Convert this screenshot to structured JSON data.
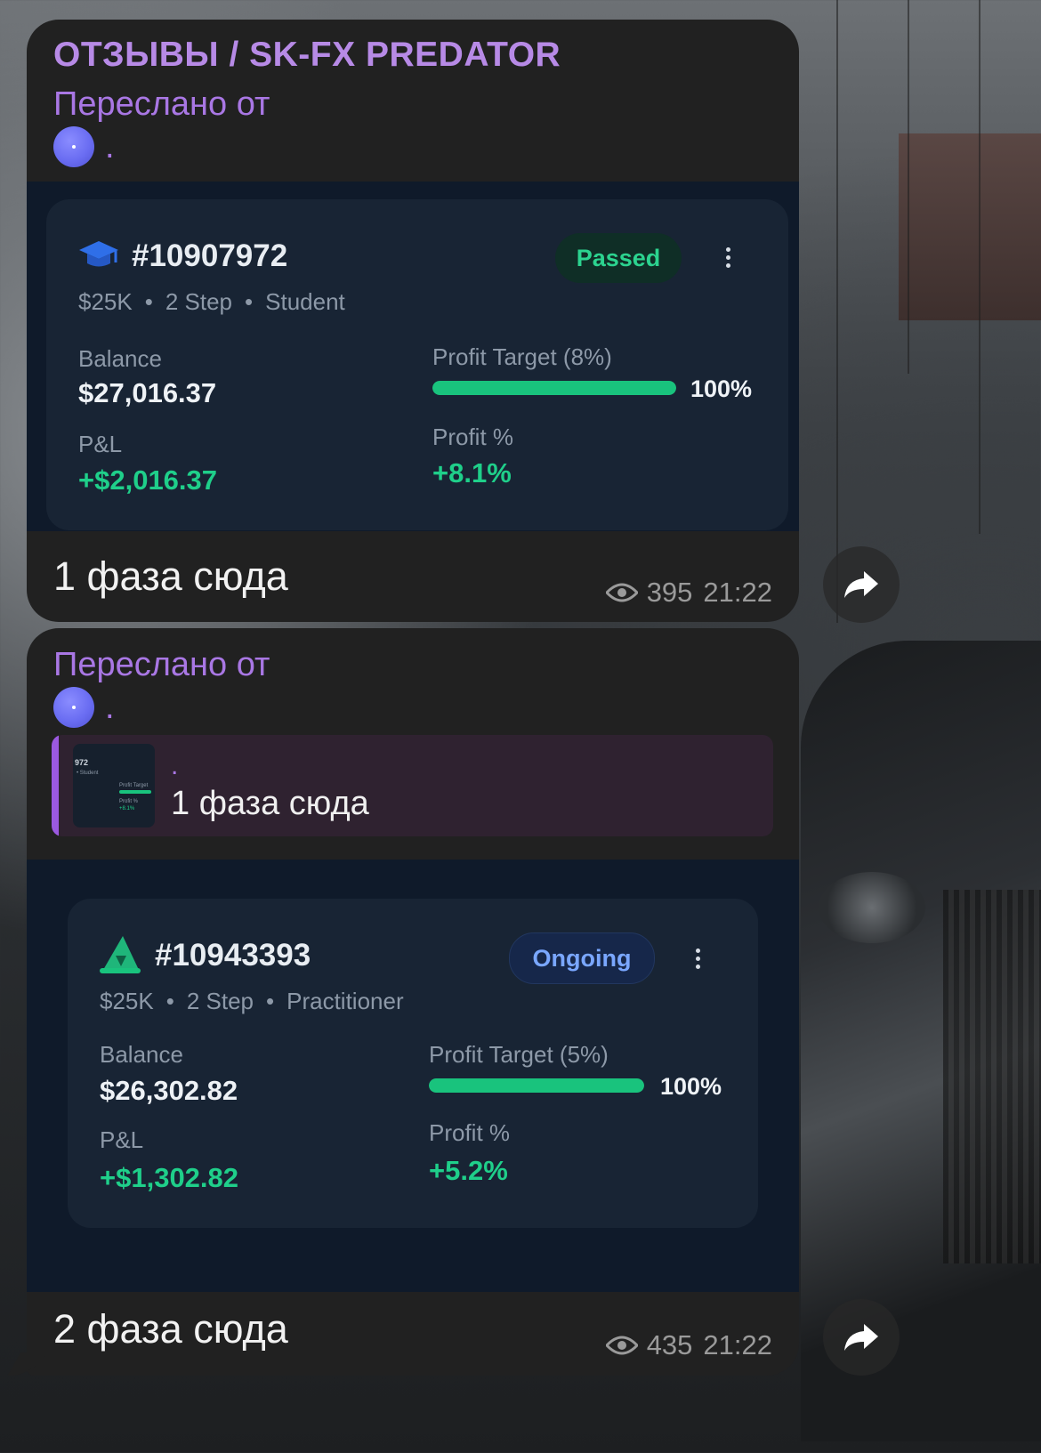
{
  "channel": {
    "title": "ОТЗЫВЫ / SK-FX PREDATOR"
  },
  "messages": [
    {
      "forwarded_label": "Переслано от",
      "forwarded_from": ".",
      "card": {
        "icon": "graduation-cap-icon",
        "account_id": "#10907972",
        "status": "Passed",
        "size": "$25K",
        "steps": "2 Step",
        "level": "Student",
        "balance_label": "Balance",
        "balance": "$27,016.37",
        "pnl_label": "P&L",
        "pnl": "+$2,016.37",
        "target_label": "Profit Target (8%)",
        "target_progress": 100,
        "target_pct": "100%",
        "profit_pct_label": "Profit %",
        "profit_pct": "+8.1%"
      },
      "text": "1 фаза сюда",
      "views": "395",
      "time": "21:22"
    },
    {
      "forwarded_label": "Переслано от",
      "forwarded_from": ".",
      "reply": {
        "name": ".",
        "text": "1 фаза сюда",
        "thumb_id": "972",
        "thumb_sub": "• Student",
        "thumb_target": "Profit Target",
        "thumb_profit": "Profit %",
        "thumb_profit_val": "+8.1%"
      },
      "card": {
        "icon": "wizard-hat-icon",
        "account_id": "#10943393",
        "status": "Ongoing",
        "size": "$25K",
        "steps": "2 Step",
        "level": "Practitioner",
        "balance_label": "Balance",
        "balance": "$26,302.82",
        "pnl_label": "P&L",
        "pnl": "+$1,302.82",
        "target_label": "Profit Target (5%)",
        "target_progress": 100,
        "target_pct": "100%",
        "profit_pct_label": "Profit %",
        "profit_pct": "+5.2%"
      },
      "text": "2 фаза сюда",
      "views": "435",
      "time": "21:22"
    }
  ],
  "colors": {
    "accent": "#a977e4",
    "positive": "#1fcf8a",
    "bubble": "#212121"
  }
}
